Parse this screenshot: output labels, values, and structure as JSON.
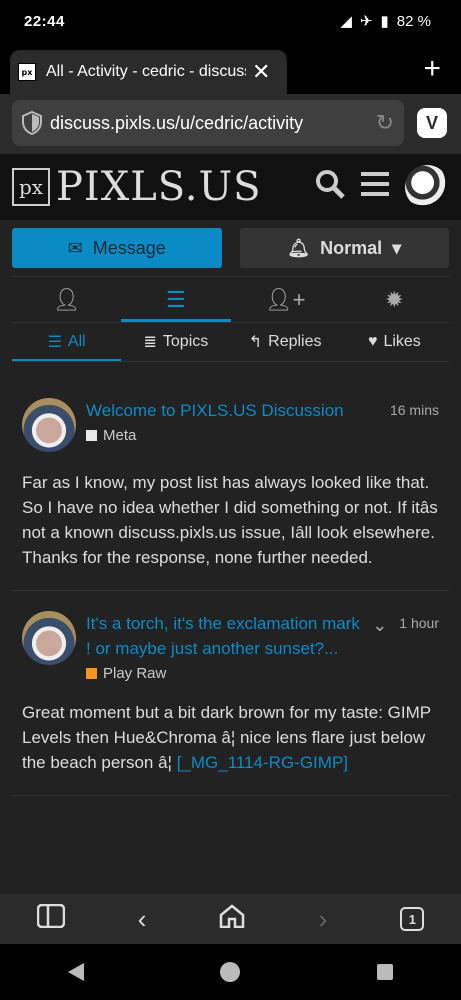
{
  "status": {
    "time": "22:44",
    "battery": "82 %"
  },
  "tab": {
    "favicon": "px",
    "title": "All - Activity - cedric - discuss.pixls.us",
    "close": "✕",
    "new_tab": "+"
  },
  "address": {
    "url": "discuss.pixls.us/u/cedric/activity"
  },
  "site": {
    "logo_mark": "px",
    "logo_text": "PIXLS.US"
  },
  "actions": {
    "message": "Message",
    "notification_level": "Normal"
  },
  "profile_nav": [
    "user-icon",
    "stream-icon",
    "user-plus-icon",
    "badge-icon"
  ],
  "sub_nav": [
    {
      "label": "All",
      "icon": "☰",
      "active": true
    },
    {
      "label": "Topics",
      "icon": "≣",
      "active": false
    },
    {
      "label": "Replies",
      "icon": "↰",
      "active": false
    },
    {
      "label": "Likes",
      "icon": "♥",
      "active": false
    }
  ],
  "posts": [
    {
      "title": "Welcome to PIXLS.US Discussion",
      "time": "16 mins",
      "category": "Meta",
      "category_color": "#e9e9e9",
      "body": "Far as I know, my post list has always looked like that. So I have no idea whether I did something or not. If itâs not a known discuss.pixls.us issue, Iâll look elsewhere. Thanks for the response, none further needed."
    },
    {
      "title": "It's a torch, it's the exclamation mark ! or maybe just another sunset?...",
      "time": "1 hour",
      "category": "Play Raw",
      "category_color": "#f7941d",
      "body": "Great moment but a bit dark brown for my taste: GIMP Levels then Hue&Chroma â¦ nice lens flare just below the beach person â¦ ",
      "link": "[_MG_1114-RG-GIMP]"
    }
  ],
  "bottom_bar": {
    "tab_count": "1"
  }
}
